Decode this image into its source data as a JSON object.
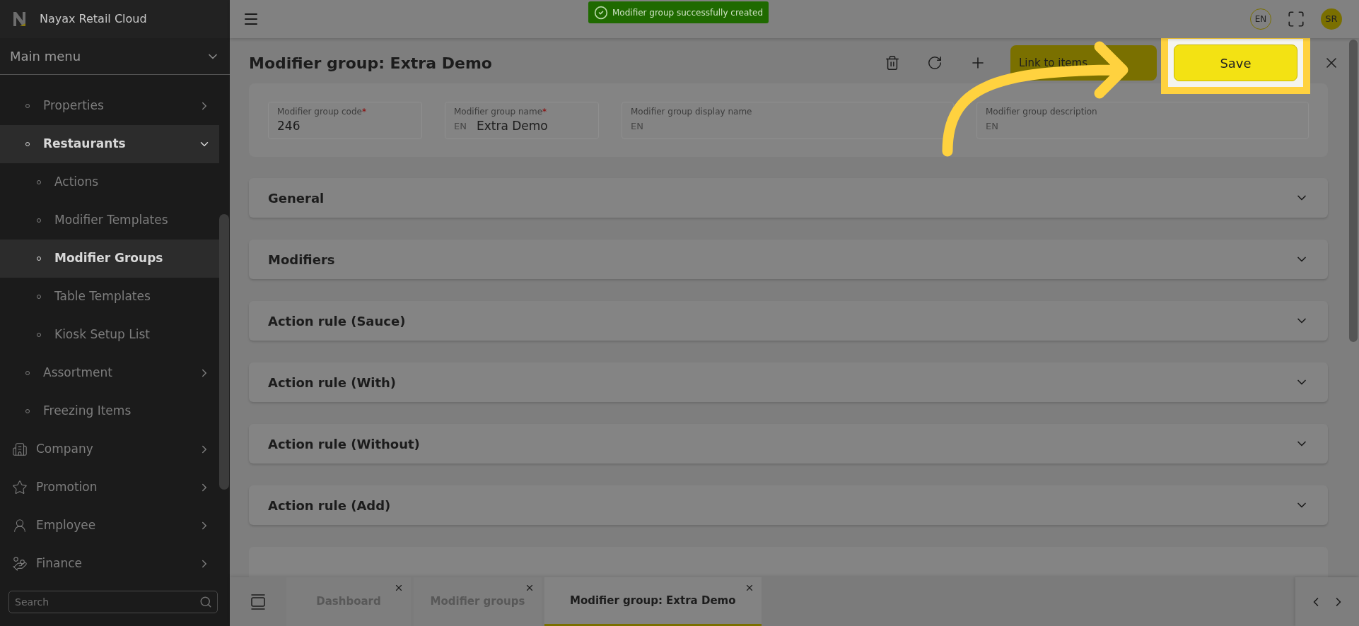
{
  "sidebar": {
    "brand": "Nayax Retail Cloud",
    "menu_title": "Main menu",
    "items": [
      {
        "kind": "group",
        "label": "Properties",
        "expanded": false,
        "selected": false
      },
      {
        "kind": "group",
        "label": "Restaurants",
        "expanded": true,
        "selected": true,
        "children": [
          {
            "label": "Actions",
            "selected": false
          },
          {
            "label": "Modifier Templates",
            "selected": false
          },
          {
            "label": "Modifier Groups",
            "selected": true
          },
          {
            "label": "Table Templates",
            "selected": false
          },
          {
            "label": "Kiosk Setup List",
            "selected": false
          }
        ]
      },
      {
        "kind": "group",
        "label": "Assortment",
        "expanded": false,
        "selected": false
      },
      {
        "kind": "link",
        "label": "Freezing Items",
        "selected": false
      },
      {
        "kind": "section",
        "label": "Company",
        "expanded": false,
        "selected": false
      },
      {
        "kind": "section",
        "label": "Promotion",
        "expanded": false,
        "selected": false
      },
      {
        "kind": "section",
        "label": "Employee",
        "expanded": false,
        "selected": false
      },
      {
        "kind": "section",
        "label": "Finance",
        "expanded": false,
        "selected": false
      }
    ],
    "search": {
      "placeholder": "Search"
    }
  },
  "toast": {
    "message": "Modifier group successfully created"
  },
  "topbar": {
    "language": "EN",
    "avatar": "SR"
  },
  "page": {
    "title": "Modifier group: Extra Demo",
    "buttons": [
      {
        "kind": "secondary",
        "label": "Link to items"
      },
      {
        "kind": "primary",
        "label": "Save"
      }
    ]
  },
  "required_symbol": "*",
  "fields": [
    {
      "label": "Modifier group code",
      "required": true,
      "value": "246"
    },
    {
      "label": "Modifier group name",
      "required": true,
      "language": "EN",
      "value": "Extra Demo"
    },
    {
      "label": "Modifier group display name",
      "required": false,
      "language": "EN"
    },
    {
      "label": "Modifier group description",
      "required": false,
      "language": "EN"
    }
  ],
  "sections": [
    {
      "title": "General",
      "expanded": false
    },
    {
      "title": "Modifiers",
      "expanded": false
    },
    {
      "title": "Action rule (Sauce)",
      "expanded": false
    },
    {
      "title": "Action rule (With)",
      "expanded": false
    },
    {
      "title": "Action rule (Without)",
      "expanded": false
    },
    {
      "title": "Action rule (Add)",
      "expanded": false
    }
  ],
  "tabs": [
    {
      "label": "Dashboard",
      "selected": false
    },
    {
      "label": "Modifier groups",
      "selected": false
    },
    {
      "label": "Modifier group: Extra Demo",
      "selected": true
    }
  ]
}
